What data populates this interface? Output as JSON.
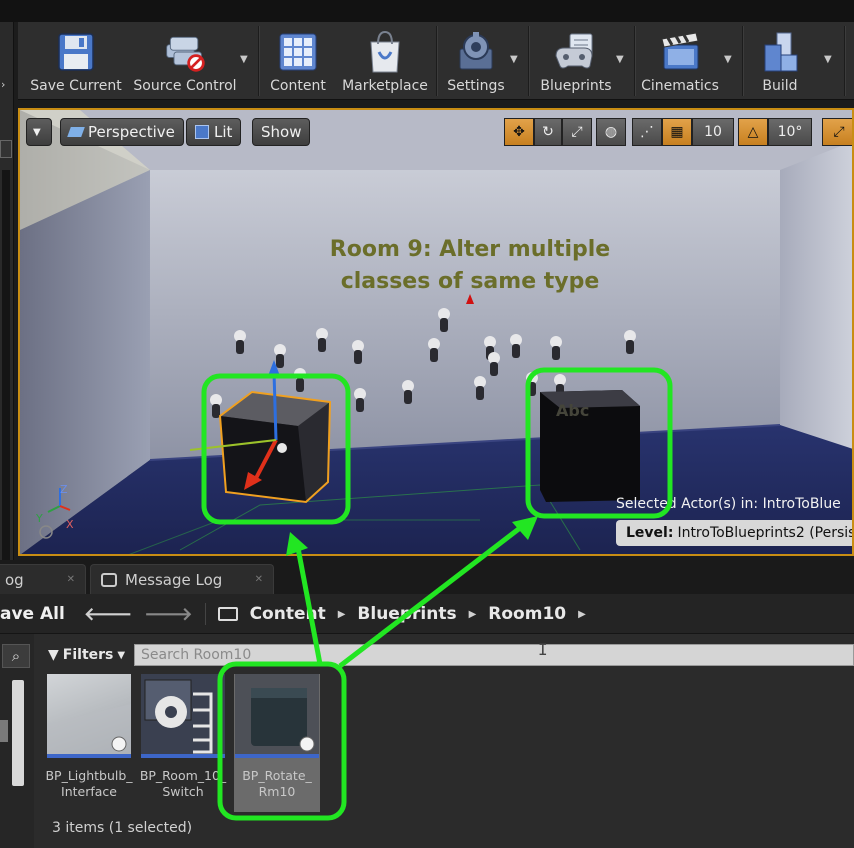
{
  "toolbar": {
    "buttons": [
      {
        "label": "Save Current"
      },
      {
        "label": "Source Control"
      },
      {
        "label": "Content"
      },
      {
        "label": "Marketplace"
      },
      {
        "label": "Settings"
      },
      {
        "label": "Blueprints"
      },
      {
        "label": "Cinematics"
      },
      {
        "label": "Build"
      }
    ]
  },
  "viewport": {
    "view_mode": "Perspective",
    "lighting": "Lit",
    "show": "Show",
    "grid_snap": "10",
    "rotation_snap": "10°",
    "room_text_line1": "Room 9: Alter multiple",
    "room_text_line2": "classes of same type",
    "cube_label": "Abc",
    "selected_actor": "Selected Actor(s) in:  IntroToBlue",
    "level_label": "Level:",
    "level_name": "IntroToBlueprints2 (Persis"
  },
  "tabs": [
    {
      "label": "og"
    },
    {
      "label": "Message Log"
    }
  ],
  "content_browser": {
    "save_all": "ave All",
    "breadcrumbs": [
      "Content",
      "Blueprints",
      "Room10"
    ],
    "filters": "Filters",
    "search_placeholder": "Search Room10",
    "assets": [
      {
        "name_line1": "BP_Lightbulb_",
        "name_line2": "Interface",
        "selected": false
      },
      {
        "name_line1": "BP_Room_10_",
        "name_line2": "Switch",
        "selected": false
      },
      {
        "name_line1": "BP_Rotate_",
        "name_line2": "Rm10",
        "selected": true
      }
    ],
    "item_count": "3 items (1 selected)"
  },
  "colors": {
    "accent_orange": "#c98e14",
    "highlight_green": "#22e622",
    "asset_underline": "#3d66c8"
  }
}
